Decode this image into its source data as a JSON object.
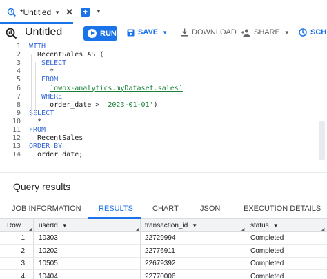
{
  "tab": {
    "title": "*Untitled"
  },
  "toolbar": {
    "title": "Untitled",
    "run_label": "RUN",
    "save_label": "SAVE",
    "download_label": "DOWNLOAD",
    "share_label": "SHARE",
    "schedule_label": "SCHE"
  },
  "editor": {
    "line_numbers": [
      "1",
      "2",
      "3",
      "4",
      "5",
      "6",
      "7",
      "8",
      "9",
      "10",
      "11",
      "12",
      "13",
      "14"
    ],
    "lines": [
      [
        {
          "t": "WITH",
          "c": "kw"
        }
      ],
      [
        {
          "t": "  RecentSales AS (",
          "c": ""
        }
      ],
      [
        {
          "t": "   SELECT",
          "c": "kw"
        }
      ],
      [
        {
          "t": "     *",
          "c": ""
        }
      ],
      [
        {
          "t": "   FROM",
          "c": "kw"
        }
      ],
      [
        {
          "t": "     ",
          "c": ""
        },
        {
          "t": "`owox-analytics.myDataset.sales`",
          "c": "str-u"
        }
      ],
      [
        {
          "t": "   WHERE",
          "c": "kw"
        }
      ],
      [
        {
          "t": "     order_date > ",
          "c": ""
        },
        {
          "t": "'2023-01-01'",
          "c": "str"
        },
        {
          "t": ")",
          "c": ""
        }
      ],
      [
        {
          "t": "SELECT",
          "c": "kw"
        }
      ],
      [
        {
          "t": "  *",
          "c": ""
        }
      ],
      [
        {
          "t": "FROM",
          "c": "kw"
        }
      ],
      [
        {
          "t": "  RecentSales",
          "c": ""
        }
      ],
      [
        {
          "t": "ORDER BY",
          "c": "kw"
        }
      ],
      [
        {
          "t": "  order_date;",
          "c": ""
        }
      ]
    ]
  },
  "results": {
    "title": "Query results",
    "tabs": [
      "JOB INFORMATION",
      "RESULTS",
      "CHART",
      "JSON",
      "EXECUTION DETAILS"
    ],
    "active_tab": "RESULTS",
    "columns": [
      "Row",
      "userId",
      "transaction_id",
      "status"
    ],
    "rows": [
      [
        "1",
        "10303",
        "22729994",
        "Completed"
      ],
      [
        "2",
        "10202",
        "22776911",
        "Completed"
      ],
      [
        "3",
        "10505",
        "22679392",
        "Completed"
      ],
      [
        "4",
        "10404",
        "22770006",
        "Completed"
      ]
    ]
  },
  "colors": {
    "accent": "#1a73e8",
    "keyword": "#3367d6",
    "string": "#188038"
  }
}
